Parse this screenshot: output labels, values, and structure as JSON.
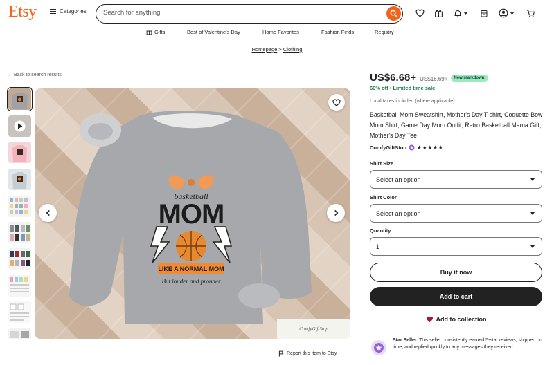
{
  "header": {
    "logo": "Etsy",
    "categories_label": "Categories",
    "search_placeholder": "Search for anything"
  },
  "nav": {
    "items": [
      "Gifts",
      "Best of Valentine's Day",
      "Home Favorites",
      "Fashion Finds",
      "Registry"
    ]
  },
  "breadcrumb": {
    "items": [
      "Homepage",
      "Clothing"
    ],
    "separator": ">"
  },
  "back_link": "Back to search results",
  "listing": {
    "price": "US$6.68+",
    "original_price": "US$16.69+",
    "markdown_badge": "New markdown!",
    "discount_text": "60% off • Limited time sale",
    "tax_note": "Local taxes included (where applicable)",
    "title": "Basketball Mom Sweatshirt, Mother's Day T-shirt, Coquette Bow Mom Shirt, Game Day Mom Outfit, Retro Basketball Mama Gift, Mother's Day Tee",
    "shop_name": "ComfyGiftStop",
    "rating_stars": "★★★★★",
    "rating": 5
  },
  "options": {
    "size_label": "Shirt Size",
    "size_value": "Select an option",
    "color_label": "Shirt Color",
    "color_value": "Select an option",
    "quantity_label": "Quantity",
    "quantity_value": "1"
  },
  "actions": {
    "buy_now": "Buy it now",
    "add_to_cart": "Add to cart",
    "add_to_collection": "Add to collection",
    "report": "Report this item to Etsy"
  },
  "star_seller": {
    "title": "Star Seller.",
    "text": "This seller consistently earned 5-star reviews, shipped on time, and replied quickly to any messages they received."
  },
  "image": {
    "watermark": "ComfyGiftStop",
    "shirt_lines": [
      "basketball",
      "MOM",
      "LIKE A NORMAL MOM",
      "But louder and prouder"
    ]
  },
  "colors": {
    "brand": "#f1641e",
    "discount_green": "#1a7a49",
    "badge_green": "#9ee8c0",
    "dark_button": "#222222",
    "heart": "#a61a2e"
  }
}
